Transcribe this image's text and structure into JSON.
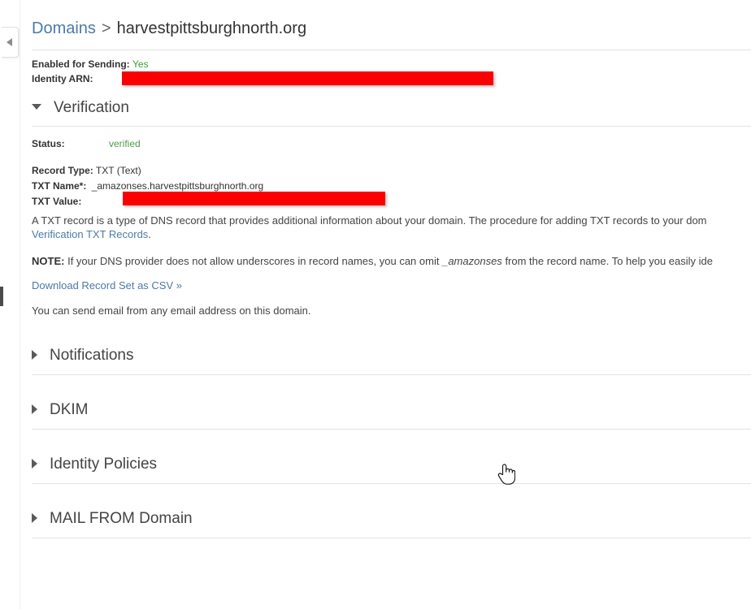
{
  "breadcrumb": {
    "parent_label": "Domains",
    "separator": ">",
    "current_label": "harvestpittsburghnorth.org"
  },
  "summary": {
    "enabled_label": "Enabled for Sending:",
    "enabled_value": "Yes",
    "arn_label": "Identity ARN:",
    "arn_value_redacted": ""
  },
  "verification": {
    "title": "Verification",
    "status_label": "Status:",
    "status_value": "verified",
    "record_type_label": "Record Type:",
    "record_type_value": "TXT (Text)",
    "txt_name_label": "TXT Name*:",
    "txt_name_value": "_amazonses.harvestpittsburghnorth.org",
    "txt_value_label": "TXT Value:",
    "txt_value_redacted": "",
    "description_line1": "A TXT record is a type of DNS record that provides additional information about your domain. The procedure for adding TXT records to your dom",
    "description_link": "Verification TXT Records",
    "description_link_suffix": ".",
    "note_label": "NOTE:",
    "note_part1": "If your DNS provider does not allow underscores in record names, you can omit",
    "note_italic": "_amazonses",
    "note_part2": "from the record name. To help you easily ide",
    "download_link": "Download Record Set as CSV »",
    "send_note": "You can send email from any email address on this domain."
  },
  "sections": [
    {
      "label": "Notifications",
      "expanded": false
    },
    {
      "label": "DKIM",
      "expanded": false
    },
    {
      "label": "Identity Policies",
      "expanded": false
    },
    {
      "label": "MAIL FROM Domain",
      "expanded": false
    }
  ],
  "icons": {
    "collapse_panel": "caret-left-icon",
    "section_expanded": "caret-down-icon",
    "section_collapsed": "caret-right-icon",
    "cursor": "pointer-hand-cursor"
  },
  "colors": {
    "link": "#4a7ba8",
    "success_green": "#3a9c3a",
    "verified_green": "#4e9a4e",
    "redaction_red": "#fb0000",
    "text": "#333333",
    "divider": "#e3e3e3"
  }
}
